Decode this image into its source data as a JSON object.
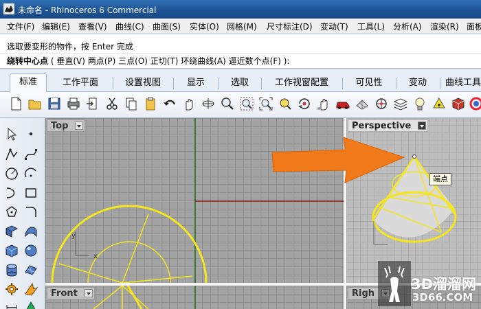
{
  "window": {
    "title": "未命名 - Rhinoceros 6 Commercial"
  },
  "menu": [
    {
      "label": "文件(F)"
    },
    {
      "label": "编辑(E)"
    },
    {
      "label": "查看(V)"
    },
    {
      "label": "曲线(C)"
    },
    {
      "label": "曲面(S)"
    },
    {
      "label": "实体(O)"
    },
    {
      "label": "网格(M)"
    },
    {
      "label": "尺寸标注(D)"
    },
    {
      "label": "变动(T)"
    },
    {
      "label": "工具(L)"
    },
    {
      "label": "分析(A)"
    },
    {
      "label": "渲染(R)"
    },
    {
      "label": "面板"
    }
  ],
  "command": {
    "history": "选取要变形的物件，按 Enter 完成",
    "prompt": "绕转中心点",
    "options": "( 垂直(V)  两点(P)  三点(O)  正切(T)  环绕曲线(A)  逼近数个点(F) ):"
  },
  "tabs": [
    {
      "label": "标准",
      "active": true
    },
    {
      "label": "工作平面"
    },
    {
      "label": "设置视图"
    },
    {
      "label": "显示"
    },
    {
      "label": "选取"
    },
    {
      "label": "工作视窗配置"
    },
    {
      "label": "可见性"
    },
    {
      "label": "变动"
    },
    {
      "label": "曲线工具"
    }
  ],
  "toolbar_icons": [
    "new-icon",
    "open-icon",
    "save-icon",
    "print-icon",
    "import-icon",
    "cut-icon",
    "copy-icon",
    "paste-icon",
    "undo-icon",
    "pan-icon",
    "rotate-view-icon",
    "zoom-icon",
    "zoom-window-icon",
    "zoom-extents-icon",
    "zoom-selected-icon",
    "rotate-3d-icon",
    "car-icon",
    "grid-icon",
    "osnap-icon",
    "layers-icon",
    "light-icon",
    "properties-icon",
    "render-icon",
    "material-icon"
  ],
  "viewports": {
    "top": {
      "label": "Top"
    },
    "perspective": {
      "label": "Perspective"
    },
    "front": {
      "label": "Front"
    },
    "right": {
      "label": "Righ"
    }
  },
  "tooltip": "端点",
  "watermark": {
    "brand": "3D溜溜网",
    "url": "3D66.COM"
  },
  "colors": {
    "accent_orange": "#f07a1a",
    "curve_yellow": "#f5e61d",
    "titlebar": "#1d5293"
  }
}
